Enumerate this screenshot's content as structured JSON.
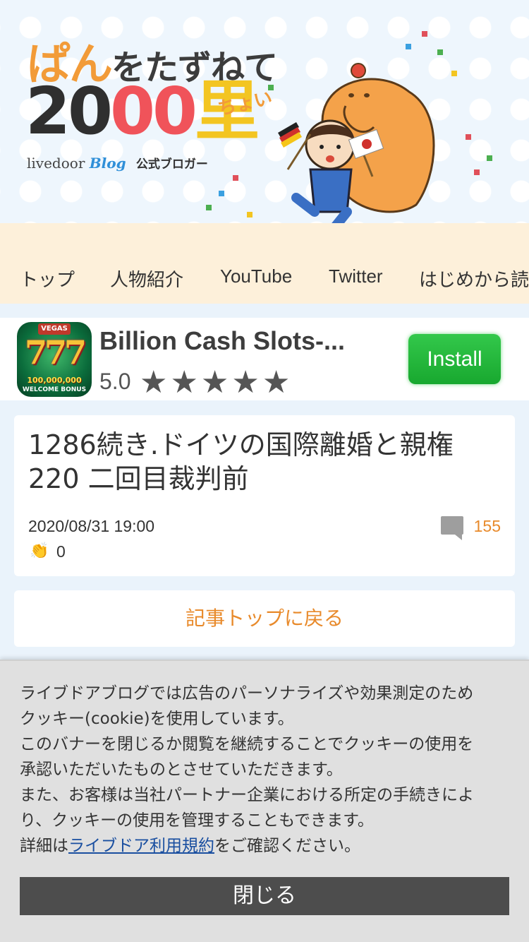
{
  "banner": {
    "title_part1": "ぱん",
    "title_part2": "をたずねて",
    "title_num_a": "20",
    "title_num_b": "00",
    "title_kanji": "里",
    "title_small": "ちょい",
    "brand_livedoor": "livedoor",
    "brand_blog": "Blog",
    "brand_official": "公式ブロガー"
  },
  "nav": {
    "items": [
      {
        "label": "トップ"
      },
      {
        "label": "人物紹介"
      },
      {
        "label": "YouTube"
      },
      {
        "label": "Twitter"
      },
      {
        "label": "はじめから読"
      }
    ]
  },
  "ad": {
    "icon_vegas": "VEGAS",
    "icon_sevens": "777",
    "icon_amount": "100,000,000",
    "icon_welcome": "WELCOME BONUS",
    "title": "Billion Cash Slots-...",
    "rating": "5.0",
    "stars": 5,
    "install_label": "Install"
  },
  "article": {
    "title": "1286続き.ドイツの国際離婚と親権220 二回目裁判前",
    "date": "2020/08/31 19:00",
    "comment_count": "155",
    "clap_count": "0"
  },
  "back_label": "記事トップに戻る",
  "cookie": {
    "lines": [
      "ライブドアブログでは広告のパーソナライズや効果測定のため",
      "クッキー(cookie)を使用しています。",
      "このバナーを閉じるか閲覧を継続することでクッキーの使用を",
      "承認いただいたものとさせていただきます。",
      "また、お客様は当社パートナー企業における所定の手続きによ",
      "り、クッキーの使用を管理することもできます。"
    ],
    "detail_prefix": "詳細は",
    "detail_link": "ライブドア利用規約",
    "detail_suffix": "をご確認ください。",
    "close_label": "閉じる"
  },
  "colors": {
    "accent_orange": "#e88a2b",
    "install_green": "#18a82f",
    "nav_bg": "#fdf0da",
    "cookie_bg": "#e0e0e0",
    "close_btn": "#4d4d4d"
  }
}
